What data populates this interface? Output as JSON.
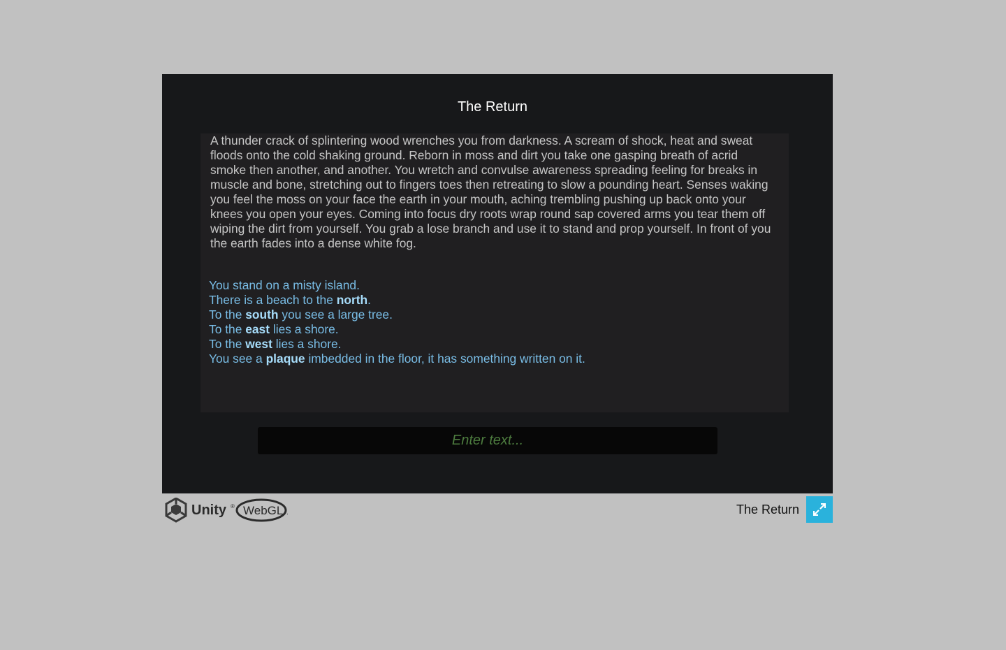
{
  "game": {
    "title": "The Return",
    "intro": "A thunder crack of splintering wood wrenches you from darkness. A scream of shock, heat and sweat floods onto the cold shaking ground. Reborn in moss and dirt you take one gasping breath of acrid smoke then another, and another. You wretch and convulse awareness spreading feeling for breaks in muscle and bone, stretching out to fingers toes then retreating to slow a pounding heart. Senses waking you feel the moss on your face the earth in your mouth, aching trembling pushing up back onto your knees you open your eyes. Coming into focus dry roots wrap round sap covered arms you tear them off wiping the dirt from yourself. You grab a lose branch and use it to stand and prop yourself. In front of you the earth fades into a dense white fog.",
    "room": [
      {
        "before": "You stand on a misty island.",
        "keyword": "",
        "after": ""
      },
      {
        "before": "There is a beach to the ",
        "keyword": "north",
        "after": "."
      },
      {
        "before": "To the ",
        "keyword": "south",
        "after": " you see a large tree."
      },
      {
        "before": "To the ",
        "keyword": "east",
        "after": " lies a shore."
      },
      {
        "before": "To the ",
        "keyword": "west",
        "after": " lies a shore."
      },
      {
        "before": "You see a ",
        "keyword": "plaque",
        "after": " imbedded in the floor, it has something written on it."
      }
    ],
    "input": {
      "placeholder": "Enter text...",
      "value": ""
    }
  },
  "footer": {
    "logo_unity": "Unity",
    "logo_webgl": "WebGL",
    "build_title": "The Return",
    "fullscreen_icon": "expand-arrows-icon"
  },
  "colors": {
    "page_bg": "#c1c1c1",
    "canvas_bg": "#17181a",
    "panel_bg": "#201f21",
    "intro_text": "#c6c6c6",
    "room_text": "#79bde6",
    "input_bg": "#070707",
    "placeholder": "#4d7c3f",
    "fullscreen_button": "#2ab2dc"
  }
}
